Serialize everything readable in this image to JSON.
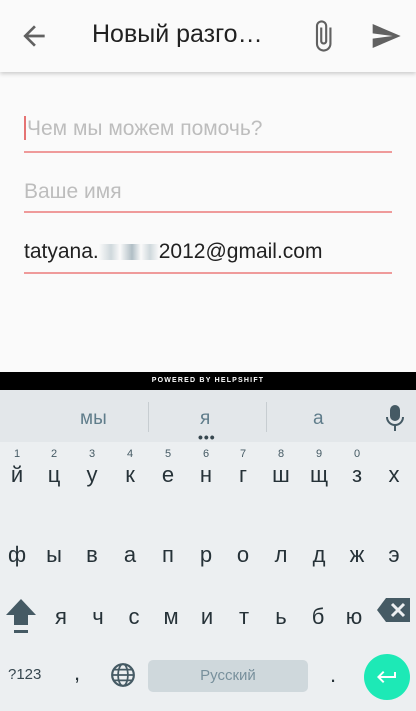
{
  "appbar": {
    "title": "Новый разго…",
    "back_icon": "arrow-back-icon",
    "attach_icon": "paperclip-icon",
    "send_icon": "send-icon"
  },
  "form": {
    "message_placeholder": "Чем мы можем помочь?",
    "name_placeholder": "Ваше имя",
    "email_prefix": "tatyana.",
    "email_suffix": "2012@gmail.com"
  },
  "powered_by": "POWERED BY HELPSHIFT",
  "keyboard": {
    "suggestions": [
      "мы",
      "я",
      "а"
    ],
    "row1": [
      {
        "ch": "й",
        "hint": "1"
      },
      {
        "ch": "ц",
        "hint": "2"
      },
      {
        "ch": "у",
        "hint": "3"
      },
      {
        "ch": "к",
        "hint": "4"
      },
      {
        "ch": "е",
        "hint": "5"
      },
      {
        "ch": "н",
        "hint": "6"
      },
      {
        "ch": "г",
        "hint": "7"
      },
      {
        "ch": "ш",
        "hint": "8"
      },
      {
        "ch": "щ",
        "hint": "9"
      },
      {
        "ch": "з",
        "hint": "0"
      },
      {
        "ch": "х",
        "hint": ""
      }
    ],
    "row2": [
      "ф",
      "ы",
      "в",
      "а",
      "п",
      "р",
      "о",
      "л",
      "д",
      "ж",
      "э"
    ],
    "row3": [
      "я",
      "ч",
      "с",
      "м",
      "и",
      "т",
      "ь",
      "б",
      "ю"
    ],
    "symbols_label": "?123",
    "comma": ",",
    "space_label": "Русский",
    "period": ".",
    "accent_color": "#1de9b6"
  }
}
